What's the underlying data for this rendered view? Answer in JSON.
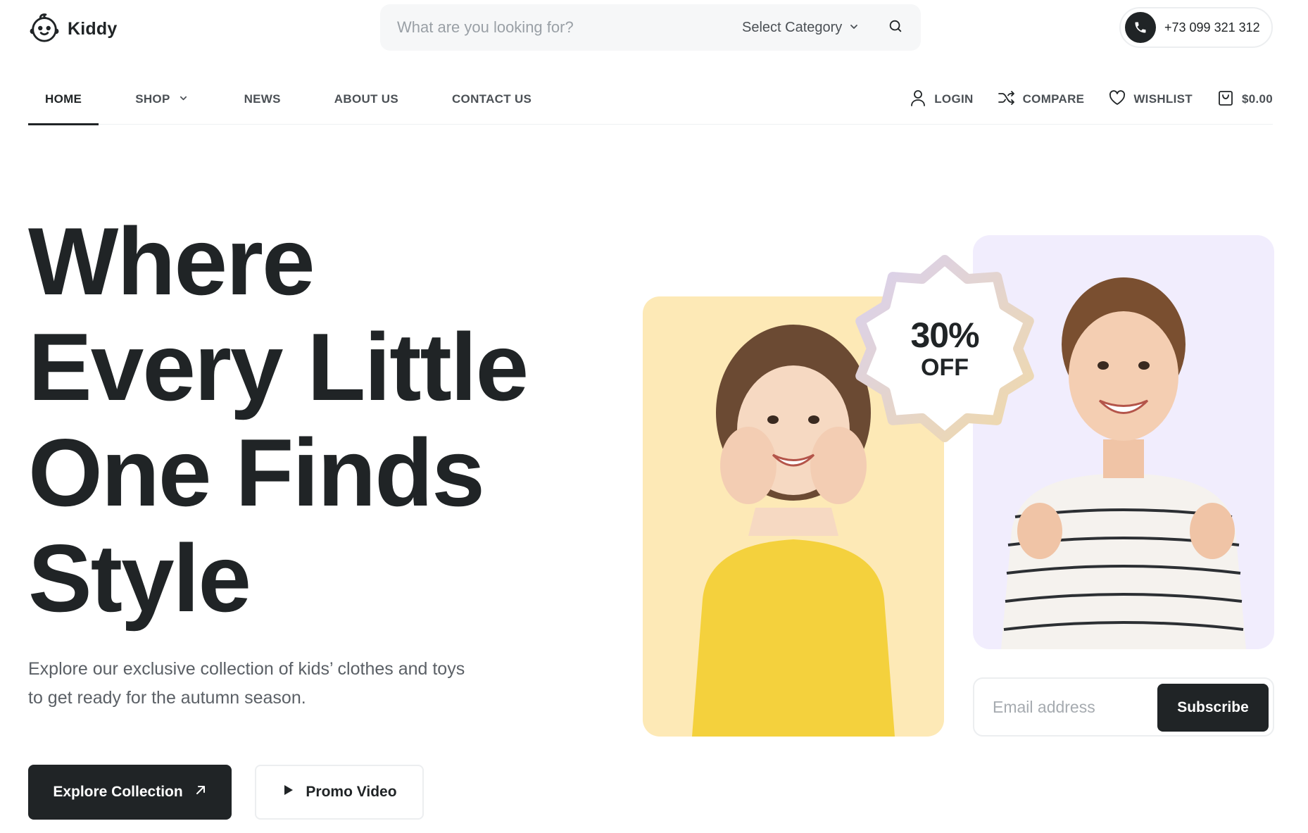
{
  "brand": {
    "name": "Kiddy",
    "logo_icon": "baby-face-icon"
  },
  "search": {
    "placeholder": "What are you looking for?",
    "category_label": "Select Category",
    "search_icon": "search-icon"
  },
  "contact": {
    "phone": "+73 099 321 312",
    "phone_icon": "phone-icon"
  },
  "nav": {
    "items": [
      {
        "label": "HOME",
        "active": true
      },
      {
        "label": "SHOP",
        "has_dropdown": true
      },
      {
        "label": "NEWS"
      },
      {
        "label": "ABOUT US"
      },
      {
        "label": "CONTACT US"
      }
    ],
    "actions": [
      {
        "label": "LOGIN",
        "icon": "user-icon"
      },
      {
        "label": "COMPARE",
        "icon": "shuffle-icon"
      },
      {
        "label": "WISHLIST",
        "icon": "heart-icon"
      },
      {
        "label": "$0.00",
        "icon": "shopping-bag-icon"
      }
    ]
  },
  "hero": {
    "title_lines": [
      "Where",
      "Every Little",
      "One Finds",
      "Style"
    ],
    "description": "Explore our exclusive collection of kids’ clothes and toys to get ready for the autumn season.",
    "primary_button": "Explore Collection",
    "secondary_button": "Promo Video"
  },
  "promo": {
    "badge_percent": "30%",
    "badge_label": "OFF",
    "yellow_card_color": "#fde9b6",
    "purple_card_color": "#f1edfd"
  },
  "subscribe": {
    "placeholder": "Email address",
    "button_label": "Subscribe"
  },
  "colors": {
    "text_dark": "#202426",
    "text_muted": "#5b6066",
    "accent_dark": "#202426"
  }
}
